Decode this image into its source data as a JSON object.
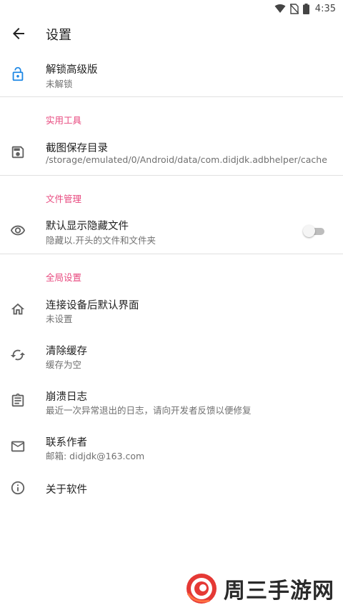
{
  "status_bar": {
    "time": "4:35"
  },
  "app_bar": {
    "title": "设置"
  },
  "items": {
    "unlock": {
      "title": "解锁高级版",
      "subtitle": "未解锁"
    },
    "screenshot_dir": {
      "title": "截图保存目录",
      "subtitle": "/storage/emulated/0/Android/data/com.didjdk.adbhelper/cache"
    },
    "show_hidden": {
      "title": "默认显示隐藏文件",
      "subtitle": "隐藏以.开头的文件和文件夹",
      "enabled": false
    },
    "default_screen": {
      "title": "连接设备后默认界面",
      "subtitle": "未设置"
    },
    "clear_cache": {
      "title": "清除缓存",
      "subtitle": "缓存为空"
    },
    "crash_log": {
      "title": "崩溃日志",
      "subtitle": "最近一次异常退出的日志，请向开发者反馈以便修复"
    },
    "contact": {
      "title": "联系作者",
      "subtitle": "邮箱: didjdk@163.com"
    },
    "about": {
      "title": "关于软件"
    }
  },
  "categories": {
    "tools": "实用工具",
    "file_mgmt": "文件管理",
    "global": "全局设置"
  },
  "watermark": {
    "text": "周三手游网"
  },
  "colors": {
    "accent": "#e84a7f",
    "unlock_icon": "#1e88e5",
    "icon_gray": "#616161"
  }
}
